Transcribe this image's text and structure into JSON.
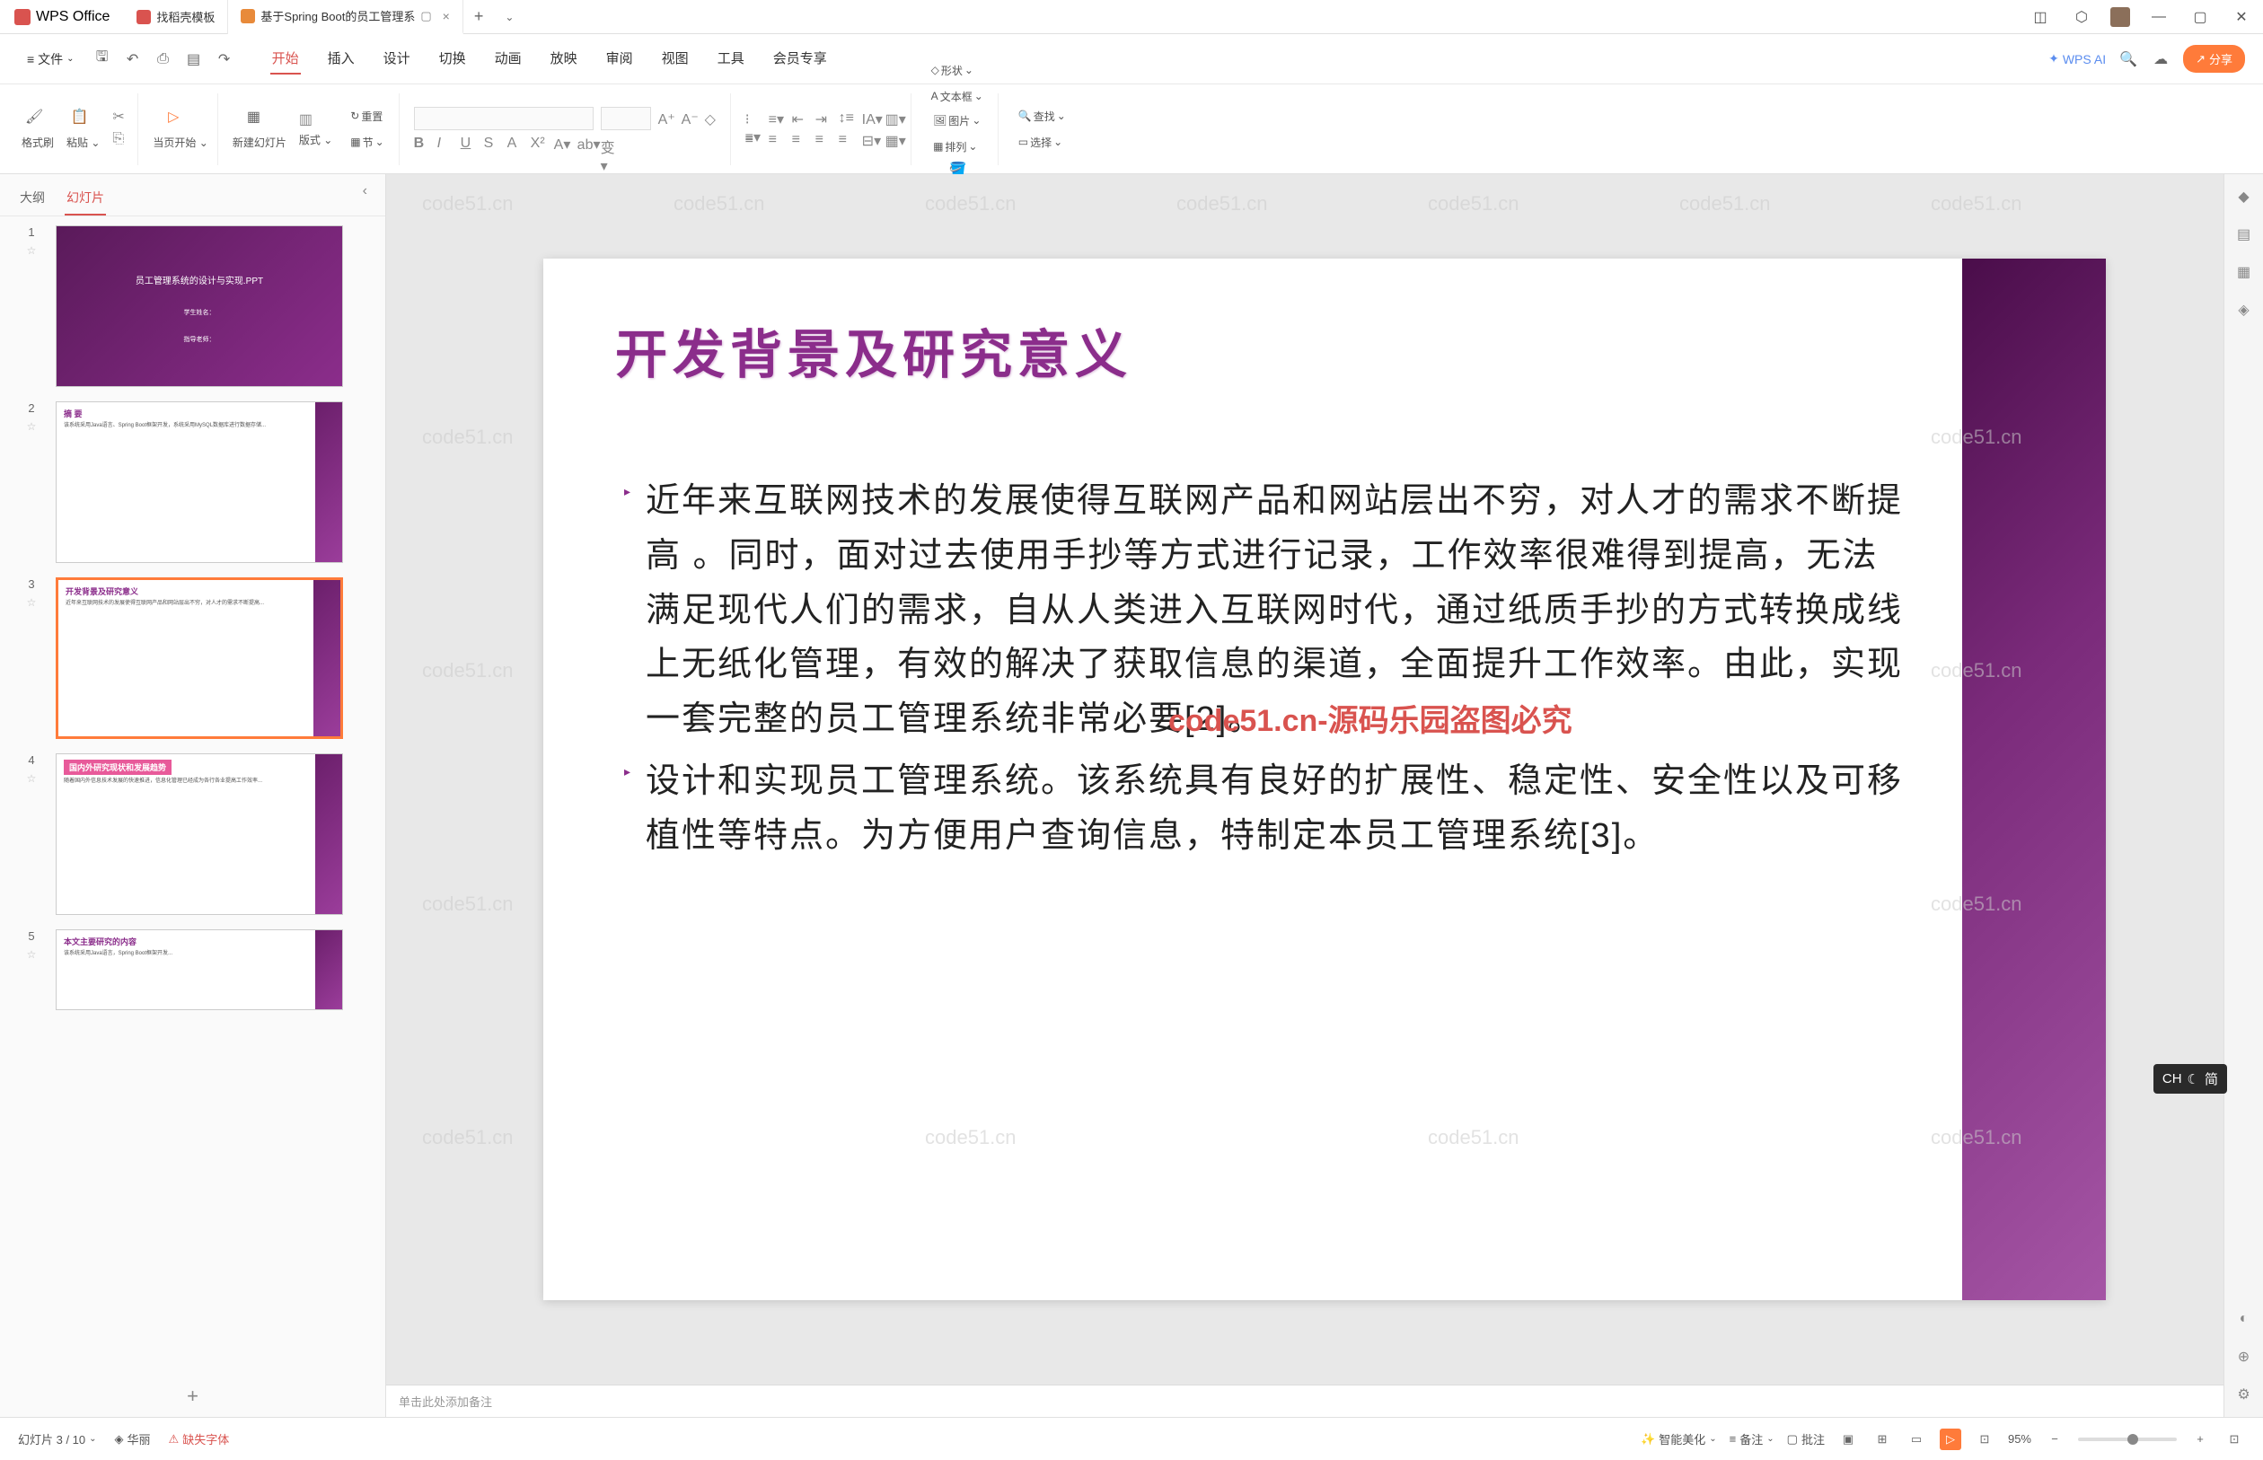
{
  "titlebar": {
    "app_name": "WPS Office",
    "tabs": [
      {
        "label": "找稻壳模板",
        "icon": "red"
      },
      {
        "label": "基于Spring Boot的员工管理系",
        "icon": "orange",
        "active": true
      }
    ]
  },
  "menu": {
    "file": "文件",
    "tabs": [
      "开始",
      "插入",
      "设计",
      "切换",
      "动画",
      "放映",
      "审阅",
      "视图",
      "工具",
      "会员专享"
    ],
    "active_tab": "开始",
    "wps_ai": "WPS AI",
    "share": "分享"
  },
  "ribbon": {
    "format_painter": "格式刷",
    "paste": "粘贴",
    "from_current": "当页开始",
    "new_slide": "新建幻灯片",
    "layout": "版式",
    "section": "节",
    "reset": "重置",
    "shape": "形状",
    "picture": "图片",
    "textbox": "文本框",
    "arrange": "排列",
    "find": "查找",
    "select": "选择"
  },
  "sidebar": {
    "tab_outline": "大纲",
    "tab_slides": "幻灯片",
    "slides": [
      {
        "num": "1",
        "title": "员工管理系统的设计与实现.PPT",
        "subtitle": "学生姓名：",
        "sub2": "指导老师：",
        "type": "cover"
      },
      {
        "num": "2",
        "title": "摘 要",
        "type": "text"
      },
      {
        "num": "3",
        "title": "开发背景及研究意义",
        "type": "text",
        "selected": true
      },
      {
        "num": "4",
        "title": "国内外研究现状和发展趋势",
        "type": "text-pink"
      },
      {
        "num": "5",
        "title": "本文主要研究的内容",
        "type": "text"
      }
    ]
  },
  "slide": {
    "title": "开发背景及研究意义",
    "para1": "近年来互联网技术的发展使得互联网产品和网站层出不穷，对人才的需求不断提高 。同时，面对过去使用手抄等方式进行记录，工作效率很难得到提高，无法满足现代人们的需求，自从人类进入互联网时代，通过纸质手抄的方式转换成线上无纸化管理，有效的解决了获取信息的渠道，全面提升工作效率。由此，实现一套完整的员工管理系统非常必要[2]。",
    "para2": "设计和实现员工管理系统。该系统具有良好的扩展性、稳定性、安全性以及可移植性等特点。为方便用户查询信息，特制定本员工管理系统[3]。",
    "overlay": "code51.cn-源码乐园盗图必究"
  },
  "watermark": "code51.cn",
  "notes": {
    "placeholder": "单击此处添加备注"
  },
  "statusbar": {
    "slide_info": "幻灯片 3 / 10",
    "theme": "华丽",
    "missing_fonts": "缺失字体",
    "smart_beauty": "智能美化",
    "notes": "备注",
    "comments": "批注",
    "zoom": "95%"
  },
  "ime": {
    "lang": "CH",
    "mode": "简"
  }
}
